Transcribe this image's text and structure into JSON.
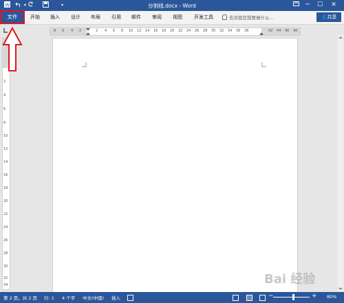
{
  "titlebar": {
    "title": "分割线.docx - Word",
    "save_icon": "save-icon",
    "undo_icon": "undo-icon",
    "redo_icon": "redo-icon",
    "customize_icon": "customize-qat-icon"
  },
  "ribbon": {
    "file_tab": "文件",
    "tabs": [
      "开始",
      "插入",
      "设计",
      "布局",
      "引用",
      "邮件",
      "审阅",
      "视图",
      "开发工具"
    ],
    "tell_me": "告诉我您想要做什么...",
    "share": "共享"
  },
  "ruler": {
    "h_ticks": [
      "8",
      "6",
      "4",
      "2",
      "2",
      "4",
      "6",
      "8",
      "10",
      "12",
      "14",
      "16",
      "18",
      "20",
      "22",
      "24",
      "26",
      "28",
      "30",
      "32",
      "34",
      "36",
      "38",
      "42",
      "44",
      "46",
      "48"
    ],
    "v_ticks": [
      "2",
      "4",
      "6",
      "8",
      "10",
      "12",
      "14",
      "16",
      "18",
      "20",
      "22",
      "24",
      "26",
      "28",
      "30",
      "32",
      "34"
    ]
  },
  "statusbar": {
    "page": "第 2 页，共 2 页",
    "row": "行: 1",
    "words": "4 个字",
    "language": "中文(中国)",
    "mode": "插入",
    "zoom": "80%"
  },
  "watermark": "Bai 经验"
}
